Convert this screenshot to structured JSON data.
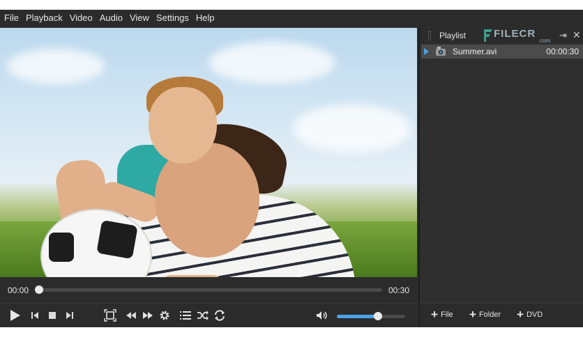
{
  "menu": [
    "File",
    "Playback",
    "Video",
    "Audio",
    "View",
    "Settings",
    "Help"
  ],
  "player": {
    "current_time": "00:00",
    "duration": "00:30",
    "seek_fraction": 0.0,
    "volume_fraction": 0.6
  },
  "controls": {
    "play_icon": "play-icon",
    "prev_icon": "skip-previous-icon",
    "stop_icon": "stop-icon",
    "next_icon": "skip-next-icon",
    "fullscreen_icon": "fullscreen-icon",
    "rewind_icon": "rewind-icon",
    "forward_icon": "fast-forward-icon",
    "settings_icon": "gear-icon",
    "playlist_icon": "list-icon",
    "shuffle_icon": "shuffle-icon",
    "repeat_icon": "repeat-icon",
    "volume_icon": "speaker-icon"
  },
  "playlist": {
    "title": "Playlist",
    "items": [
      {
        "name": "Summer.avi",
        "duration": "00:00:30"
      }
    ],
    "footer": {
      "file_label": "File",
      "folder_label": "Folder",
      "dvd_label": "DVD"
    }
  },
  "watermark": {
    "main": "FILECR",
    "sub": ".com"
  },
  "colors": {
    "accent": "#4aa3e8",
    "background": "#2d2d2d",
    "panel": "#2f2f2f",
    "selected_row": "#4b4b4b"
  }
}
